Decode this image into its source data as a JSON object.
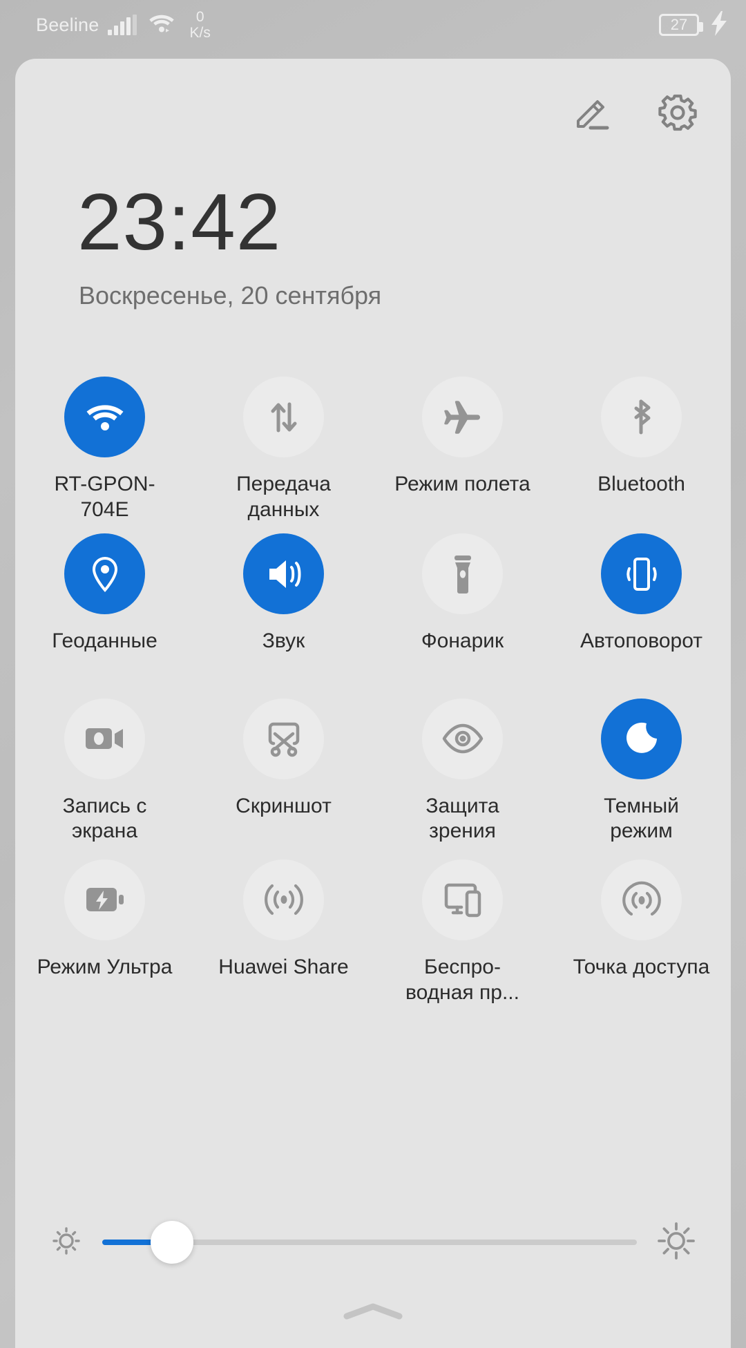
{
  "status_bar": {
    "carrier": "Beeline",
    "signal_icon": "cellular-signal-icon",
    "wifi_icon": "wifi-icon",
    "network_speed_value": "0",
    "network_speed_unit": "K/s",
    "battery_percent": "27",
    "charging_icon": "lightning-bolt-icon"
  },
  "panel": {
    "edit_button_label": "edit-icon",
    "settings_button_label": "gear-icon",
    "time": "23:42",
    "date": "Воскресенье, 20 сентября",
    "accent_color": "#1271d6",
    "panel_background": "#e4e4e4",
    "inactive_tile_color": "#ebebeb"
  },
  "toggles": [
    {
      "label": "RT-GPON-704E",
      "icon": "wifi-icon",
      "active": true
    },
    {
      "label": "Передача данных",
      "icon": "mobile-data-icon",
      "active": false
    },
    {
      "label": "Режим полета",
      "icon": "airplane-icon",
      "active": false
    },
    {
      "label": "Bluetooth",
      "icon": "bluetooth-icon",
      "active": false
    },
    {
      "label": "Геоданные",
      "icon": "location-icon",
      "active": true
    },
    {
      "label": "Звук",
      "icon": "sound-icon",
      "active": true
    },
    {
      "label": "Фонарик",
      "icon": "flashlight-icon",
      "active": false
    },
    {
      "label": "Автоповорот",
      "icon": "auto-rotate-icon",
      "active": true
    },
    {
      "label": "Запись с экрана",
      "icon": "screen-record-icon",
      "active": false
    },
    {
      "label": "Скриншот",
      "icon": "scissors-icon",
      "active": false
    },
    {
      "label": "Защита зрения",
      "icon": "eye-comfort-icon",
      "active": false
    },
    {
      "label": "Темный режим",
      "icon": "dark-mode-icon",
      "active": true
    },
    {
      "label": "Режим Ультра",
      "icon": "battery-saver-icon",
      "active": false
    },
    {
      "label": "Huawei Share",
      "icon": "huawei-share-icon",
      "active": false
    },
    {
      "label": "Беспро-водная пр...",
      "icon": "wireless-projection-icon",
      "active": false
    },
    {
      "label": "Точка доступа",
      "icon": "hotspot-icon",
      "active": false
    }
  ],
  "brightness": {
    "low_icon": "brightness-low-icon",
    "high_icon": "brightness-high-icon",
    "value_percent": 13
  },
  "footer": {
    "collapse_handle_icon": "chevron-up-icon"
  }
}
